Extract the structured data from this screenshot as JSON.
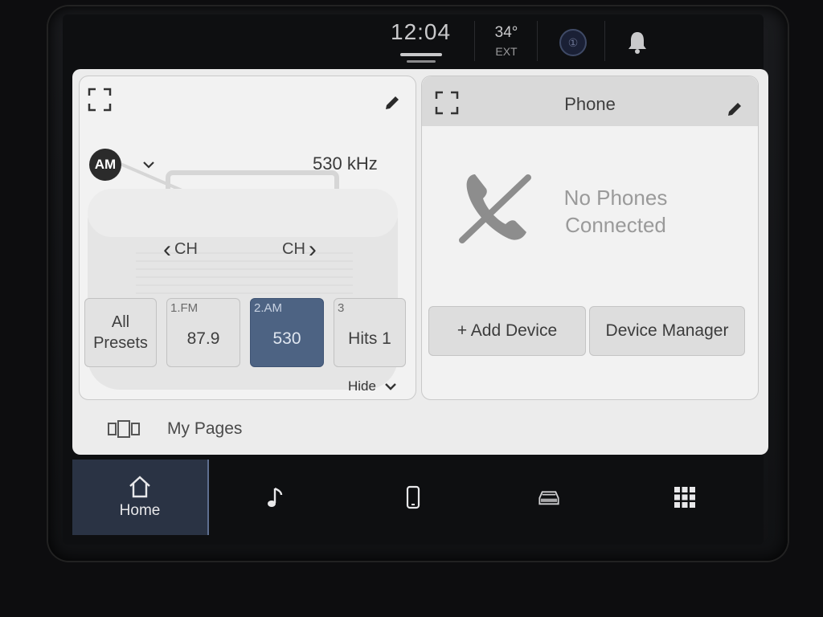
{
  "status_bar": {
    "time": "12:04",
    "temperature": "34°",
    "temperature_label": "EXT",
    "compass_glyph": "①"
  },
  "radio": {
    "band": "AM",
    "frequency": "530 kHz",
    "ch_prev_label": "CH",
    "ch_next_label": "CH",
    "all_presets_label": "All Presets",
    "presets": [
      {
        "num": "1.FM",
        "value": "87.9"
      },
      {
        "num": "2.AM",
        "value": "530"
      },
      {
        "num": "3",
        "value": "Hits 1"
      }
    ],
    "active_preset_index": 1,
    "hide_label": "Hide"
  },
  "phone": {
    "title": "Phone",
    "status_line1": "No Phones",
    "status_line2": "Connected",
    "add_device_label": "+ Add Device",
    "device_manager_label": "Device Manager"
  },
  "my_pages_label": "My Pages",
  "nav": {
    "home_label": "Home"
  },
  "colors": {
    "active_preset": "#4d6383",
    "home_tab_bg": "#2a3344"
  }
}
